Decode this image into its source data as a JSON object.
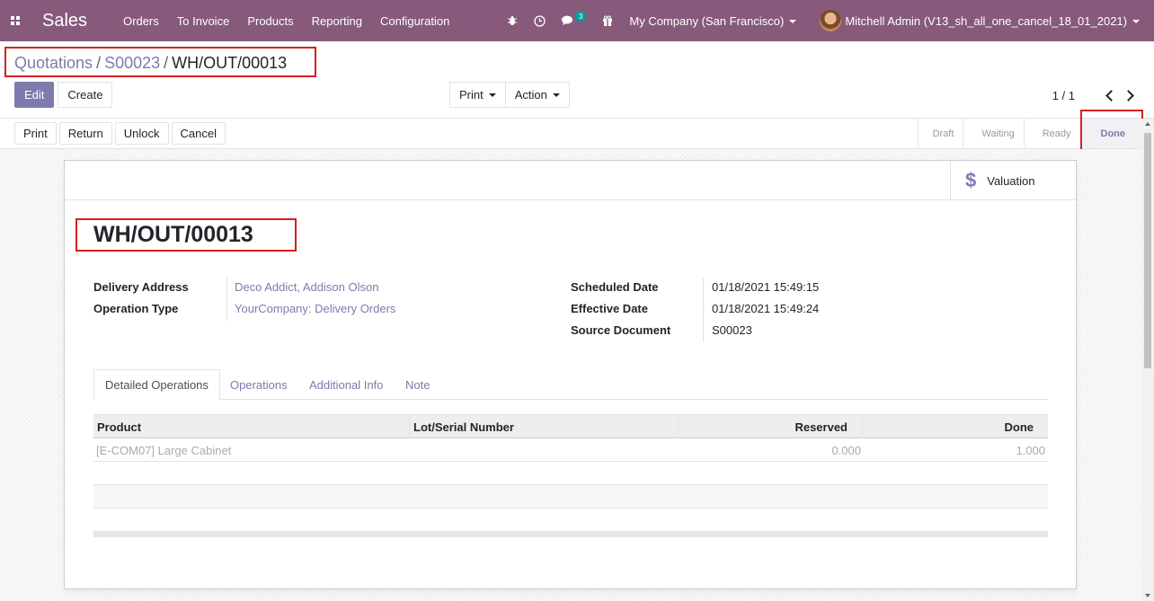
{
  "navbar": {
    "app_name": "Sales",
    "menu": [
      "Orders",
      "To Invoice",
      "Products",
      "Reporting",
      "Configuration"
    ],
    "message_count": "3",
    "company": "My Company (San Francisco)",
    "user": "Mitchell Admin (V13_sh_all_one_cancel_18_01_2021)"
  },
  "breadcrumb": {
    "items": [
      "Quotations",
      "S00023"
    ],
    "current": "WH/OUT/00013"
  },
  "control_panel": {
    "edit_label": "Edit",
    "create_label": "Create",
    "print_label": "Print",
    "action_label": "Action",
    "pager": "1 / 1"
  },
  "statusbar": {
    "buttons": [
      "Print",
      "Return",
      "Unlock",
      "Cancel"
    ],
    "stages": [
      "Draft",
      "Waiting",
      "Ready",
      "Done"
    ],
    "active_stage": "Done"
  },
  "sheet": {
    "valuation_label": "Valuation",
    "title": "WH/OUT/00013",
    "left_fields": [
      {
        "label": "Delivery Address",
        "value": "Deco Addict, Addison Olson"
      },
      {
        "label": "Operation Type",
        "value": "YourCompany: Delivery Orders"
      }
    ],
    "right_fields": [
      {
        "label": "Scheduled Date",
        "value": "01/18/2021 15:49:15"
      },
      {
        "label": "Effective Date",
        "value": "01/18/2021 15:49:24"
      },
      {
        "label": "Source Document",
        "value": "S00023"
      }
    ],
    "tabs": [
      "Detailed Operations",
      "Operations",
      "Additional Info",
      "Note"
    ],
    "table": {
      "columns": [
        "Product",
        "Lot/Serial Number",
        "Reserved",
        "Done"
      ],
      "rows": [
        {
          "product": "[E-COM07] Large Cabinet",
          "lot": "",
          "reserved": "0.000",
          "done": "1.000"
        }
      ]
    }
  },
  "colors": {
    "brand": "#875a7b",
    "accent": "#7c7bad",
    "highlight_box": "#d81e1e"
  }
}
